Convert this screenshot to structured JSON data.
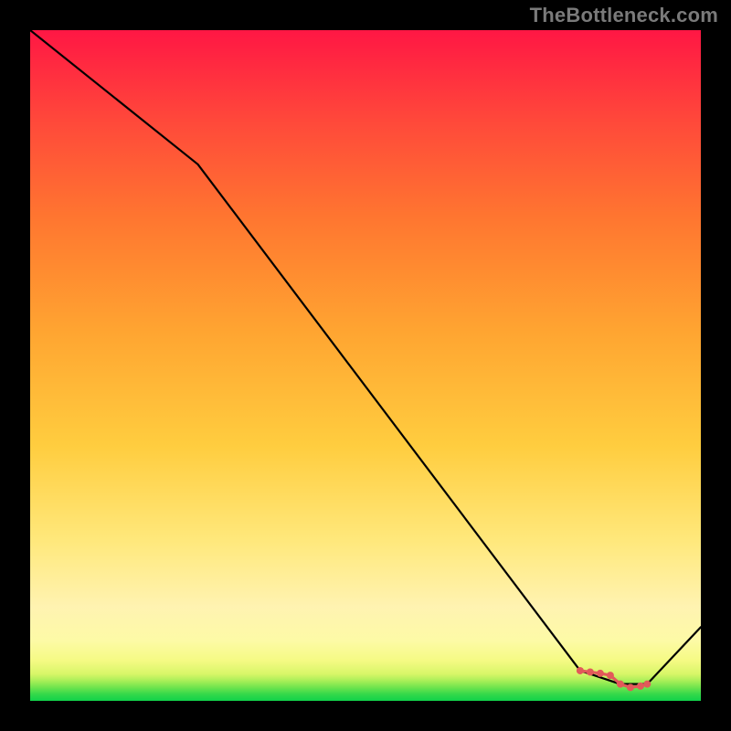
{
  "attribution": "TheBottleneck.com",
  "chart_data": {
    "type": "line",
    "title": "",
    "xlabel": "",
    "ylabel": "",
    "xlim": [
      0,
      100
    ],
    "ylim": [
      0,
      100
    ],
    "x": [
      0,
      25,
      82,
      88,
      92,
      100
    ],
    "values": [
      100,
      80,
      4.5,
      2.5,
      2.5,
      11
    ],
    "marker_points_x": [
      82,
      83.5,
      85,
      86.5,
      88,
      89.5,
      91,
      92
    ],
    "marker_points_y": [
      4.5,
      4.3,
      4.1,
      3.8,
      2.5,
      2.0,
      2.2,
      2.5
    ],
    "gradient_bands": [
      {
        "stop": 0.0,
        "color": "#11d24a"
      },
      {
        "stop": 0.01,
        "color": "#34d94a"
      },
      {
        "stop": 0.02,
        "color": "#6fe44e"
      },
      {
        "stop": 0.03,
        "color": "#a9ef58"
      },
      {
        "stop": 0.04,
        "color": "#d8f668"
      },
      {
        "stop": 0.06,
        "color": "#f5fa84"
      },
      {
        "stop": 0.09,
        "color": "#fdfaa6"
      },
      {
        "stop": 0.14,
        "color": "#fff3b1"
      },
      {
        "stop": 0.24,
        "color": "#ffe87b"
      },
      {
        "stop": 0.38,
        "color": "#ffcd3f"
      },
      {
        "stop": 0.55,
        "color": "#ffa531"
      },
      {
        "stop": 0.72,
        "color": "#ff7630"
      },
      {
        "stop": 0.86,
        "color": "#ff4a3a"
      },
      {
        "stop": 1.0,
        "color": "#ff1744"
      }
    ],
    "line_color": "#000000",
    "marker_color": "#e25a5a",
    "background_outside": "#000000"
  }
}
